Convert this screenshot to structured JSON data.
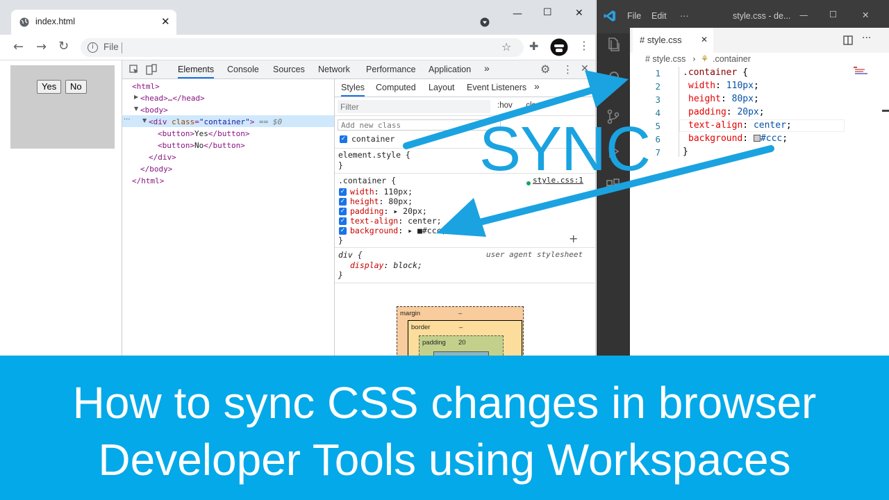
{
  "browser": {
    "tab_title": "index.html",
    "url_label": "File",
    "controls": {
      "minimize": "—",
      "maximize": "☐",
      "close": "✕"
    }
  },
  "page": {
    "buttons": [
      "Yes",
      "No"
    ]
  },
  "devtools": {
    "tabs": [
      "Elements",
      "Console",
      "Sources",
      "Network",
      "Performance",
      "Application"
    ],
    "more": "»",
    "dom": {
      "html_open": "<html>",
      "head": "<head>…</head>",
      "body_open": "<body>",
      "div_tag": "<div ",
      "div_attr_name": "class",
      "div_attr_value": "\"container\"",
      "div_close_bracket": ">",
      "div_suffix": " == $0",
      "btn_yes_open": "<button>",
      "btn_yes_text": "Yes",
      "btn_yes_close": "</button>",
      "btn_no_open": "<button>",
      "btn_no_text": "No",
      "btn_no_close": "</button>",
      "div_close": "</div>",
      "body_close": "</body>",
      "html_close": "</html>",
      "ellipsis": "···"
    },
    "styles": {
      "tabs": [
        "Styles",
        "Computed",
        "Layout",
        "Event Listeners"
      ],
      "filter_placeholder": "Filter",
      "hov": ":hov",
      "cls": ".cls",
      "add_class_placeholder": "Add new class",
      "class_chip": "container",
      "element_style": "element.style {",
      "close_brace": "}",
      "container_selector": ".container {",
      "source_link": "style.css:1",
      "props": [
        {
          "name": "width",
          "value": "110px;"
        },
        {
          "name": "height",
          "value": "80px;"
        },
        {
          "name": "padding",
          "value": "▸ 20px;"
        },
        {
          "name": "text-align",
          "value": "center;"
        },
        {
          "name": "background",
          "value": "▸ ■#ccc;"
        }
      ],
      "plus": "+",
      "ua_selector": "div {",
      "ua_label": "user agent stylesheet",
      "ua_prop": "display",
      "ua_value": "block;"
    },
    "box_model": {
      "margin_label": "margin",
      "margin_value": "–",
      "border_label": "border",
      "border_value": "–",
      "padding_label": "padding",
      "padding_value": "20"
    }
  },
  "vscode": {
    "menu": [
      "File",
      "Edit",
      "···"
    ],
    "window_title": "style.css - de...",
    "tab_label": "# style.css",
    "tab_close": "✕",
    "breadcrumb_file": "# style.css",
    "breadcrumb_symbol": ".container",
    "line_numbers": [
      "1",
      "2",
      "3",
      "4",
      "5",
      "6",
      "7"
    ],
    "code": {
      "selector": ".container",
      "open": " {",
      "lines": [
        {
          "prop": "width",
          "value": "110px"
        },
        {
          "prop": "height",
          "value": "80px"
        },
        {
          "prop": "padding",
          "value": "20px"
        },
        {
          "prop": "text-align",
          "value": "center"
        },
        {
          "prop": "background",
          "value": "#ccc"
        }
      ],
      "close": "}"
    }
  },
  "overlay": {
    "sync": "SYNC",
    "accent_color": "#1aa3e0"
  },
  "banner": {
    "line1": "How to sync CSS changes in browser",
    "line2": "Developer Tools using Workspaces",
    "color": "#03a9e9"
  }
}
